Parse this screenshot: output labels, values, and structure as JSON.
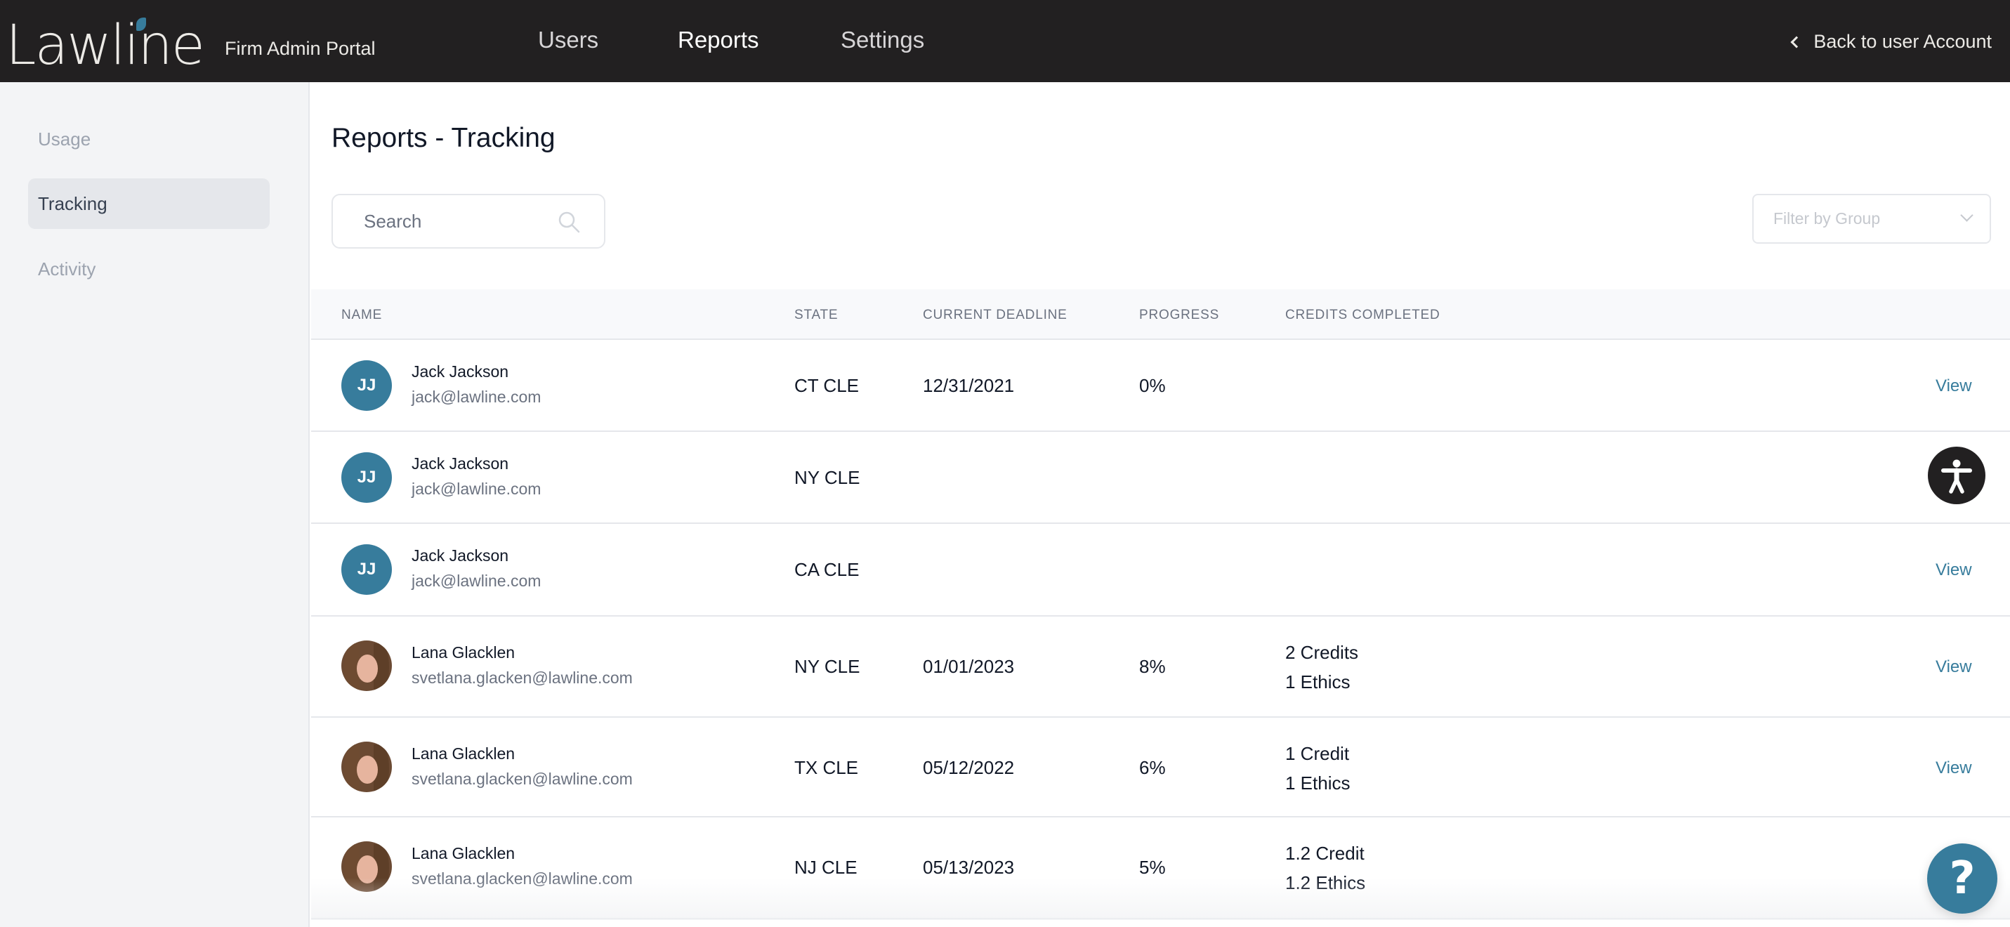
{
  "header": {
    "logo_text": "Lawline",
    "portal_name": "Firm Admin Portal",
    "nav": [
      {
        "label": "Users",
        "active": false
      },
      {
        "label": "Reports",
        "active": true
      },
      {
        "label": "Settings",
        "active": false
      }
    ],
    "back_link": "Back to user Account"
  },
  "sidebar": {
    "items": [
      {
        "label": "Usage",
        "active": false
      },
      {
        "label": "Tracking",
        "active": true
      },
      {
        "label": "Activity",
        "active": false
      }
    ]
  },
  "main": {
    "title": "Reports - Tracking",
    "search": {
      "placeholder": "Search",
      "value": ""
    },
    "filter": {
      "placeholder": "Filter by Group"
    },
    "table": {
      "columns": [
        "Name",
        "State",
        "Current Deadline",
        "Progress",
        "Credits Completed"
      ],
      "rows": [
        {
          "initials": "JJ",
          "avatar": "initials",
          "name": "Jack Jackson",
          "email": "jack@lawline.com",
          "state": "CT CLE",
          "deadline": "12/31/2021",
          "progress": "0%",
          "credits": "",
          "ethics": "",
          "action": "View"
        },
        {
          "initials": "JJ",
          "avatar": "initials",
          "name": "Jack Jackson",
          "email": "jack@lawline.com",
          "state": "NY CLE",
          "deadline": "",
          "progress": "",
          "credits": "",
          "ethics": "",
          "action": ""
        },
        {
          "initials": "JJ",
          "avatar": "initials",
          "name": "Jack Jackson",
          "email": "jack@lawline.com",
          "state": "CA CLE",
          "deadline": "",
          "progress": "",
          "credits": "",
          "ethics": "",
          "action": "View"
        },
        {
          "initials": "",
          "avatar": "photo",
          "name": "Lana Glacklen",
          "email": "svetlana.glacken@lawline.com",
          "state": "NY CLE",
          "deadline": "01/01/2023",
          "progress": "8%",
          "credits": "2 Credits",
          "ethics": "1 Ethics",
          "action": "View"
        },
        {
          "initials": "",
          "avatar": "photo",
          "name": "Lana Glacklen",
          "email": "svetlana.glacken@lawline.com",
          "state": "TX CLE",
          "deadline": "05/12/2022",
          "progress": "6%",
          "credits": "1 Credit",
          "ethics": "1 Ethics",
          "action": "View"
        },
        {
          "initials": "",
          "avatar": "photo",
          "name": "Lana Glacklen",
          "email": "svetlana.glacken@lawline.com",
          "state": "NJ CLE",
          "deadline": "05/13/2023",
          "progress": "5%",
          "credits": "1.2 Credit",
          "ethics": "1.2 Ethics",
          "action": ""
        }
      ]
    }
  },
  "floating": {
    "accessibility_icon": "accessibility-icon",
    "help_icon": "question-mark-icon",
    "help_glyph": "?"
  },
  "colors": {
    "header_bg": "#222021",
    "accent": "#377C9C",
    "sidebar_bg": "#F3F4F6",
    "table_header_bg": "#F8F9FB"
  }
}
